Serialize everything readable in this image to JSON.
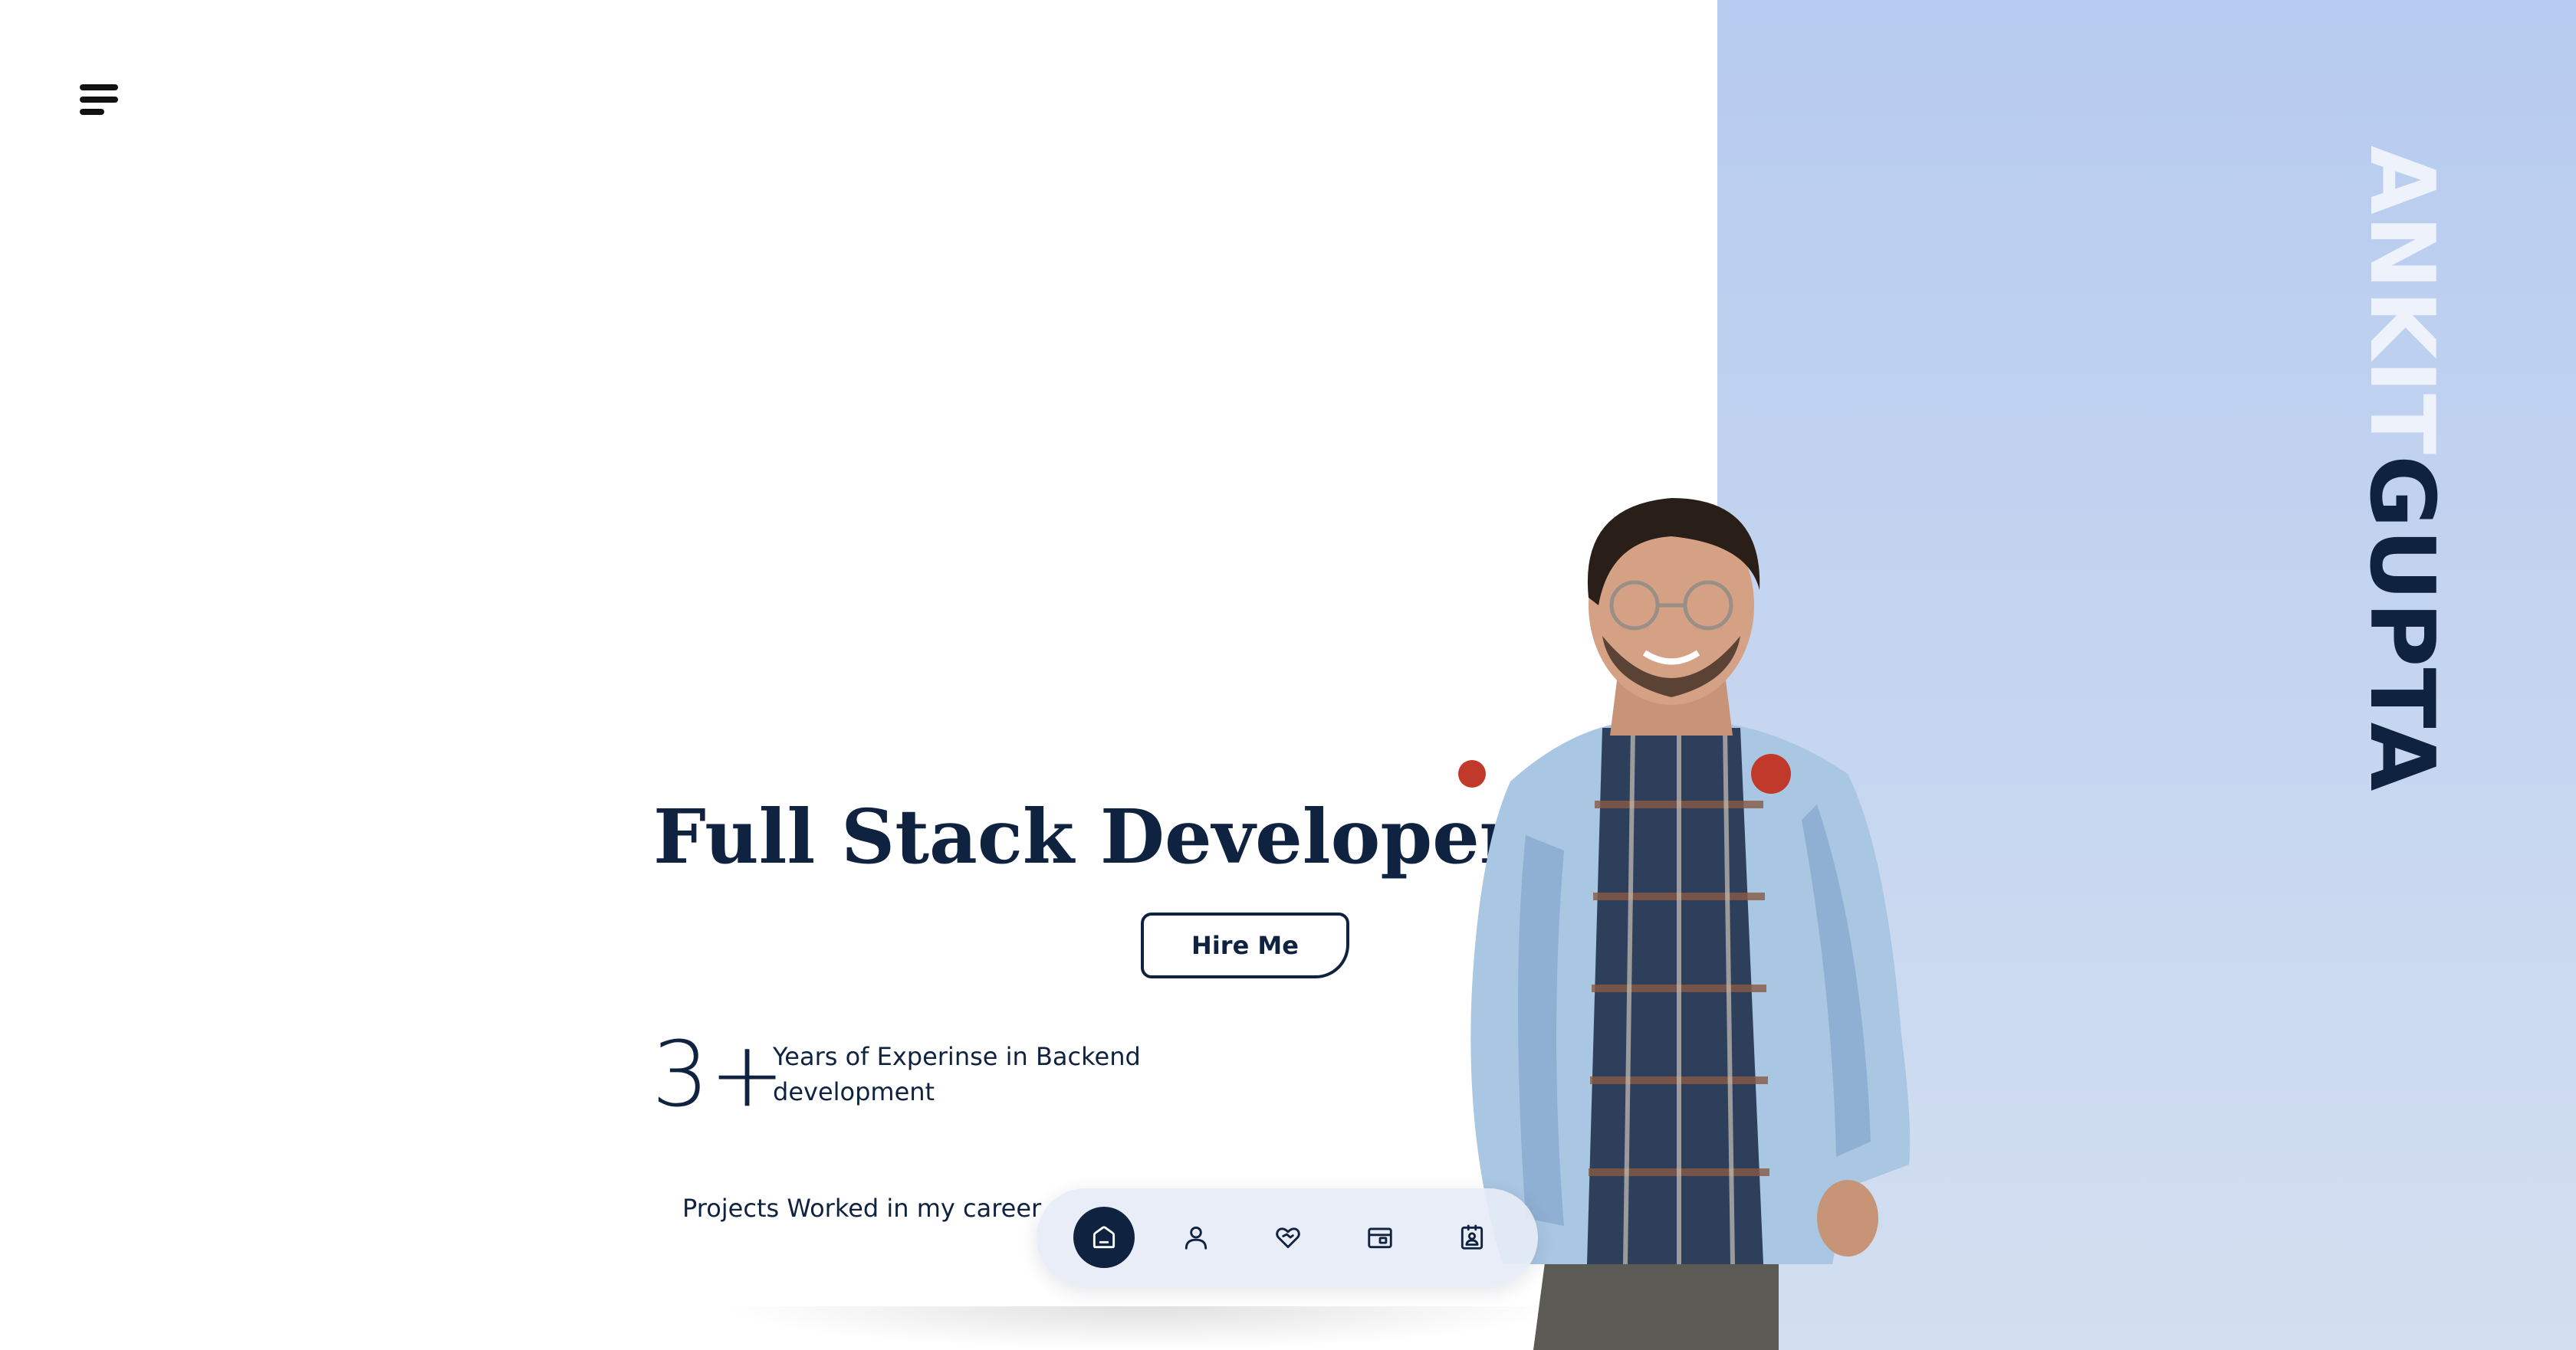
{
  "header": {
    "menu_icon": "hamburger-menu-icon"
  },
  "side_name": {
    "first": "ANKIT",
    "last": "GUPTA"
  },
  "hero": {
    "title": "Full Stack Developer",
    "hire_button_label": "Hire Me"
  },
  "stats": {
    "experience_value": "3+",
    "experience_label": "Years of Experinse in Backend development",
    "projects_label": "Projects Worked in my career"
  },
  "bottom_nav": {
    "items": [
      {
        "icon": "home-icon",
        "active": true
      },
      {
        "icon": "user-icon",
        "active": false
      },
      {
        "icon": "heart-handshake-icon",
        "active": false
      },
      {
        "icon": "briefcase-icon",
        "active": false
      },
      {
        "icon": "contact-card-icon",
        "active": false
      }
    ]
  },
  "colors": {
    "primary_navy": "#0f2340",
    "panel_blue": "#b7cbf0",
    "nav_bg": "#e6ecf6"
  }
}
